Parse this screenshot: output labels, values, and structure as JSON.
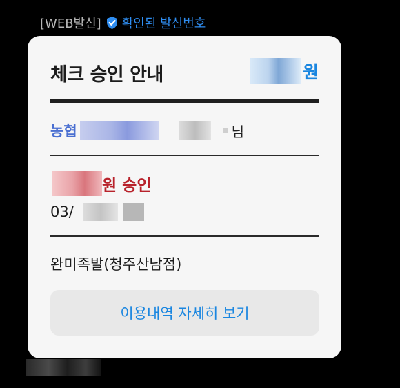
{
  "sender": {
    "web_tag": "[WEB발신]",
    "verified_label": "확인된 발신번호",
    "verified_icon": "verified-shield-check-icon",
    "accent_color": "#2f8df0"
  },
  "card": {
    "title": "체크 승인 안내",
    "amount_suffix": "원",
    "customer": {
      "bank": "농협",
      "suffix": "님"
    },
    "approval": {
      "label": "원 승인",
      "date_prefix": "03/"
    },
    "merchant": "완미족발(청주산남점)",
    "details_button_label": "이용내역 자세히 보기"
  },
  "colors": {
    "background": "#000000",
    "card": "#f6f6f6",
    "amount_blue": "#1a86e0",
    "bank_blue": "#4a6fd1",
    "approval_red": "#b8222b",
    "button_bg": "#e8e8e8"
  }
}
